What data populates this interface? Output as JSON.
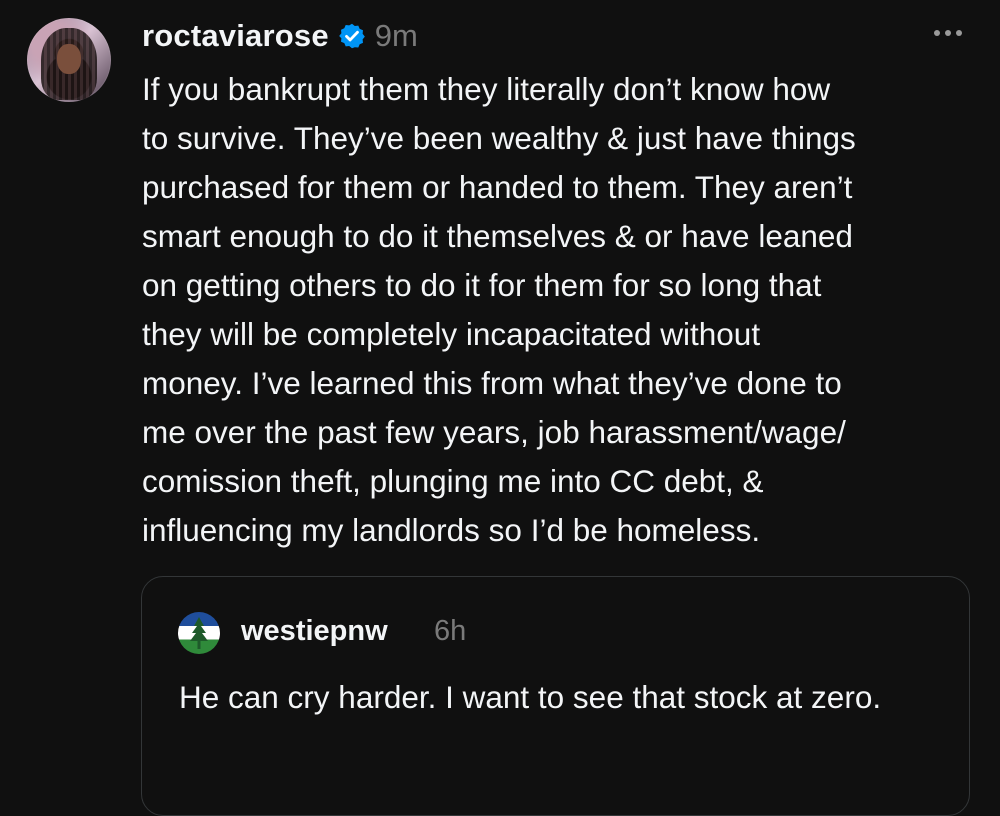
{
  "post": {
    "username": "roctaviarose",
    "timestamp": "9m",
    "verified_icon": "verified-badge-icon",
    "more_icon": "more-options-icon",
    "text": "If you bankrupt them they literally don’t know how\nto survive. They’ve been wealthy & just have things\npurchased for them or handed to them. They aren’t\nsmart enough to do it themselves & or have leaned\non getting others to do it for them for so long that\nthey will be completely incapacitated without\nmoney. I’ve learned this from what they’ve done to\nme over the past few years, job harassment/wage/\ncomission theft, plunging me into CC debt, &\ninfluencing my landlords so I’d be homeless."
  },
  "quote": {
    "username": "westiepnw",
    "timestamp": "6h",
    "text": "He can cry harder. I want to see that stock at zero."
  },
  "colors": {
    "background": "#101010",
    "text": "#f3f5f7",
    "muted": "#7a7a7a",
    "verified": "#0095f6",
    "card_border": "#333638"
  }
}
